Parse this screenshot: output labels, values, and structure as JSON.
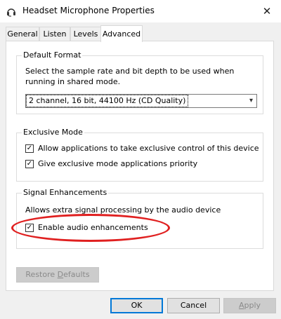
{
  "window": {
    "title": "Headset Microphone Properties",
    "icon": "microphone-icon",
    "close_glyph": "✕"
  },
  "tabs": [
    {
      "label": "General"
    },
    {
      "label": "Listen"
    },
    {
      "label": "Levels"
    },
    {
      "label": "Advanced",
      "selected": true
    }
  ],
  "default_format": {
    "title": "Default Format",
    "description": "Select the sample rate and bit depth to be used when running in shared mode.",
    "selected_value": "2 channel, 16 bit, 44100 Hz (CD Quality)",
    "arrow_glyph": "▾"
  },
  "exclusive_mode": {
    "title": "Exclusive Mode",
    "options": [
      {
        "label": "Allow applications to take exclusive control of this device",
        "checked": true
      },
      {
        "label": "Give exclusive mode applications priority",
        "checked": true
      }
    ]
  },
  "signal_enhancements": {
    "title": "Signal Enhancements",
    "description": "Allows extra signal processing by the audio device",
    "enable": {
      "label": "Enable audio enhancements",
      "checked": true
    }
  },
  "check_glyph": "✓",
  "restore": {
    "label_pre": "Restore ",
    "label_acc": "D",
    "label_post": "efaults"
  },
  "buttons": {
    "ok": "OK",
    "cancel": "Cancel",
    "apply_acc": "A",
    "apply_post": "pply"
  },
  "colors": {
    "annotation": "#e02020",
    "focus": "#0078d7",
    "disabled_text": "#8a8a8a"
  }
}
